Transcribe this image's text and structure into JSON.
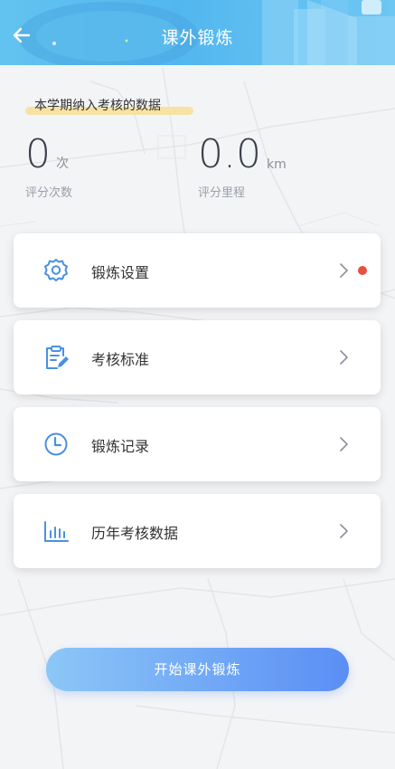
{
  "header": {
    "title": "课外锻炼",
    "back_icon": "arrow-left-icon"
  },
  "stats": {
    "section_label": "本学期纳入考核的数据",
    "count": {
      "value": "0",
      "unit": "次",
      "caption": "评分次数"
    },
    "distance": {
      "value": "0.0",
      "unit": "km",
      "caption": "评分里程"
    }
  },
  "menu": {
    "items": [
      {
        "label": "锻炼设置",
        "icon": "gear-icon",
        "badge": true,
        "badge_color": "#e8503f"
      },
      {
        "label": "考核标准",
        "icon": "clipboard-edit-icon",
        "badge": false
      },
      {
        "label": "锻炼记录",
        "icon": "clock-icon",
        "badge": false
      },
      {
        "label": "历年考核数据",
        "icon": "bar-chart-icon",
        "badge": false
      }
    ]
  },
  "start_button": {
    "label": "开始课外锻炼"
  },
  "colors": {
    "header": "#52b7ef",
    "icon_blue": "#4a90e2",
    "button_start": "#8cc7f6",
    "button_end": "#5b8ef5",
    "highlight": "#f7e2a3"
  }
}
